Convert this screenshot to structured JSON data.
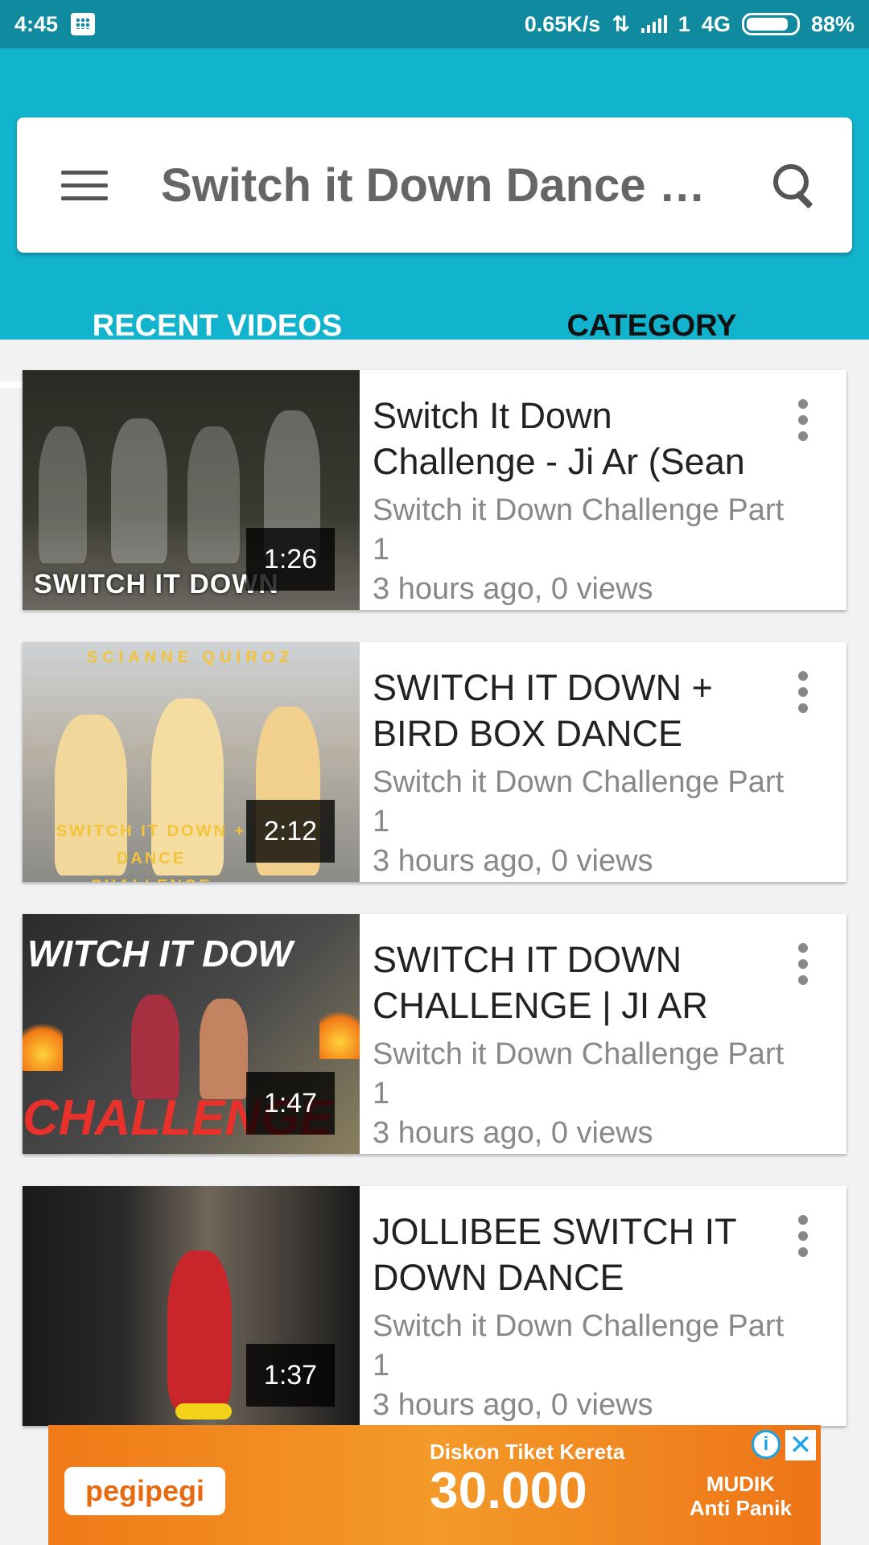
{
  "status_bar": {
    "time": "4:45",
    "speed": "0.65K/s",
    "sim": "1",
    "network": "4G",
    "battery": "88%"
  },
  "header": {
    "title": "Switch it Down Dance C...",
    "menu_icon": "hamburger-menu-icon",
    "search_icon": "search-icon"
  },
  "tabs": [
    {
      "label": "RECENT VIDEOS",
      "active": true
    },
    {
      "label": "CATEGORY",
      "active": false
    }
  ],
  "videos": [
    {
      "title": "Switch It Down Challenge - Ji Ar (Sean",
      "channel": "Switch it Down Challenge Part 1",
      "meta": "3 hours ago, 0 views",
      "duration": "1:26",
      "thumb_caption": "SWITCH IT DOWN"
    },
    {
      "title": "SWITCH IT DOWN + BIRD BOX DANCE",
      "channel": "Switch it Down Challenge Part 1",
      "meta": "3 hours ago, 0 views",
      "duration": "2:12",
      "thumb_caption": "SWITCH IT DOWN + DANCE CHALLENGE",
      "thumb_top": "SCIANNE QUIROZ"
    },
    {
      "title": "SWITCH IT DOWN CHALLENGE | JI AR",
      "channel": "Switch it Down Challenge Part 1",
      "meta": "3 hours ago, 0 views",
      "duration": "1:47",
      "thumb_caption": "CHALLENGE",
      "thumb_top": "WITCH IT DOW"
    },
    {
      "title": "JOLLIBEE SWITCH IT DOWN DANCE",
      "channel": "Switch it Down Challenge Part 1",
      "meta": "3 hours ago, 0 views",
      "duration": "1:37",
      "thumb_caption": ""
    }
  ],
  "ad": {
    "logo": "pegipegi",
    "headline": "Diskon Tiket Kereta",
    "price": "30.000",
    "tag": "MUDIK",
    "subtag": "Anti Panik"
  }
}
